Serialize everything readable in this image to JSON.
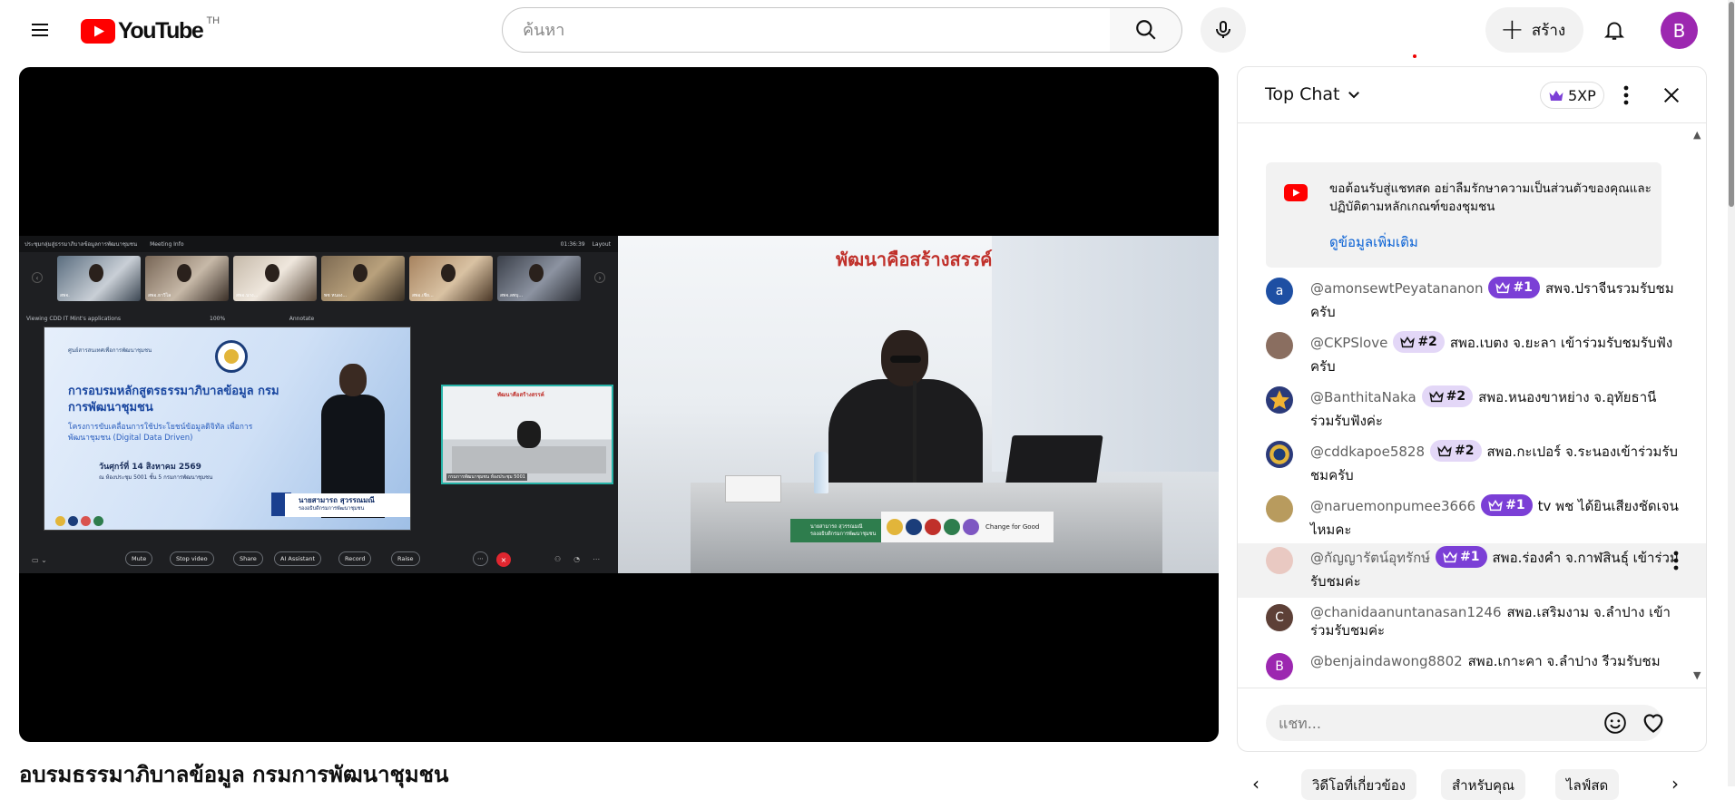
{
  "header": {
    "logo_text": "YouTube",
    "country_code": "TH",
    "search_placeholder": "ค้นหา",
    "create_label": "สร้าง",
    "avatar_letter": "B",
    "icons": [
      "menu-icon",
      "search-icon",
      "mic-icon",
      "plus-icon",
      "bell-icon"
    ]
  },
  "video": {
    "title": "อบรมธรรมาภิบาลข้อมูล กรมการพัฒนาชุมชน",
    "zoom": {
      "topbar_left": "ประชุมกลุ่มสู่ธรรมาภิบาลข้อมูลการพัฒนาชุมชน",
      "meeting_info": "Meeting Info",
      "time": "01:36:39",
      "view_label": "Layout",
      "viewing": "Viewing CDD IT Mint's applications",
      "zoom_level": "100%",
      "annotate": "Annotate",
      "thumbs": [
        "สพจ.",
        "สพอ.ธาวิไล",
        "สพอ.นาง...",
        "พช หนอง...",
        "สพอ.เชีย...",
        "สพจ.ลพบุ..."
      ],
      "controls": [
        "Mute",
        "Stop video",
        "Share",
        "AI Assistant",
        "Record",
        "Raise"
      ],
      "slide": {
        "org": "ศูนย์สารสนเทศเพื่อการพัฒนาชุมชน",
        "title": "การอบรมหลักสูตรธรรมาภิบาลข้อมูล กรมการพัฒนาชุมชน",
        "subtitle": "โครงการขับเคลื่อนการใช้ประโยชน์ข้อมูลดิจิทัล เพื่อการพัฒนาชุมชน (Digital Data Driven)",
        "date": "วันศุกร์ที่ 14 สิงหาคม 2569",
        "venue": "ณ ห้องประชุม 5001 ชั้น 5 กรมการพัฒนาชุมชน",
        "name": "นายสามารถ สุวรรณมณี",
        "role": "รองอธิบดีกรมการพัฒนาชุมชน"
      },
      "pip_banner": "พัฒนาคือสร้างสรรค์",
      "pip_label": "กรมการพัฒนาชุมชน ห้องประชุม 5001"
    },
    "room": {
      "banner": "พัฒนาคือสร้างสรรค์",
      "nameplate_1": "นายสามารถ สุวรรณมณี",
      "nameplate_2": "รองอธิบดีกรมการพัฒนาชุมชน",
      "change_label": "Change for Good"
    }
  },
  "chat": {
    "mode_label": "Top Chat",
    "xp_label": "5XP",
    "welcome_text": "ขอต้อนรับสู่แชทสด อย่าลืมรักษาความเป็นส่วนตัวของคุณและปฏิบัติตามหลักเกณฑ์ของชุมชน",
    "learn_more": "ดูข้อมูลเพิ่มเติม",
    "input_placeholder": "แชท...",
    "messages": [
      {
        "author": "@amonsewtPeyatananon",
        "badge": "#1",
        "text": "สพจ.ปราจีนรวมรับชมครับ",
        "avatar_letter": "a",
        "avatar_color": "#1e4fa3"
      },
      {
        "author": "@CKPSlove",
        "badge": "#2",
        "text": "สพอ.เบตง จ.ยะลา เข้าร่วมรับชมรับฟังครับ",
        "avatar_letter": "",
        "avatar_color": "#8a6e60"
      },
      {
        "author": "@BanthitaNaka",
        "badge": "#2",
        "text": "สพอ.หนองขาหย่าง จ.อุทัยธานี ร่วมรับฟังค่ะ",
        "avatar_letter": "",
        "avatar_color": "#e8a53a"
      },
      {
        "author": "@cddkapoe5828",
        "badge": "#2",
        "text": "สพอ.กะเปอร์ จ.ระนองเข้าร่วมรับชมครับ",
        "avatar_letter": "",
        "avatar_color": "#2b3a7a"
      },
      {
        "author": "@naruemonpumee3666",
        "badge": "#1",
        "text": "tv พช ได้ยินเสียงชัดเจนไหมคะ",
        "avatar_letter": "",
        "avatar_color": "#b89b5e"
      },
      {
        "author": "@กัญญารัตน์อุทรักษ์",
        "badge": "#1",
        "text": "สพอ.ร่องคำ จ.กาฬสินธุ์ เข้าร่วมรับชมค่ะ",
        "avatar_letter": "",
        "avatar_color": "#e9c9c2"
      },
      {
        "author": "@chanidaanuntanasan1246",
        "badge": "",
        "text": "สพอ.เสริมงาม จ.ลำปาง เข้าร่วมรับชมค่ะ",
        "avatar_letter": "C",
        "avatar_color": "#5d4037"
      },
      {
        "author": "@benjaindawong8802",
        "badge": "",
        "text": "สพอ.เกาะคา จ.ลำปาง รีวมรับชม",
        "avatar_letter": "B",
        "avatar_color": "#9c27b0"
      }
    ]
  },
  "chips": [
    "วิดีโอที่เกี่ยวข้อง",
    "สำหรับคุณ",
    "ไลฟ์สด"
  ]
}
